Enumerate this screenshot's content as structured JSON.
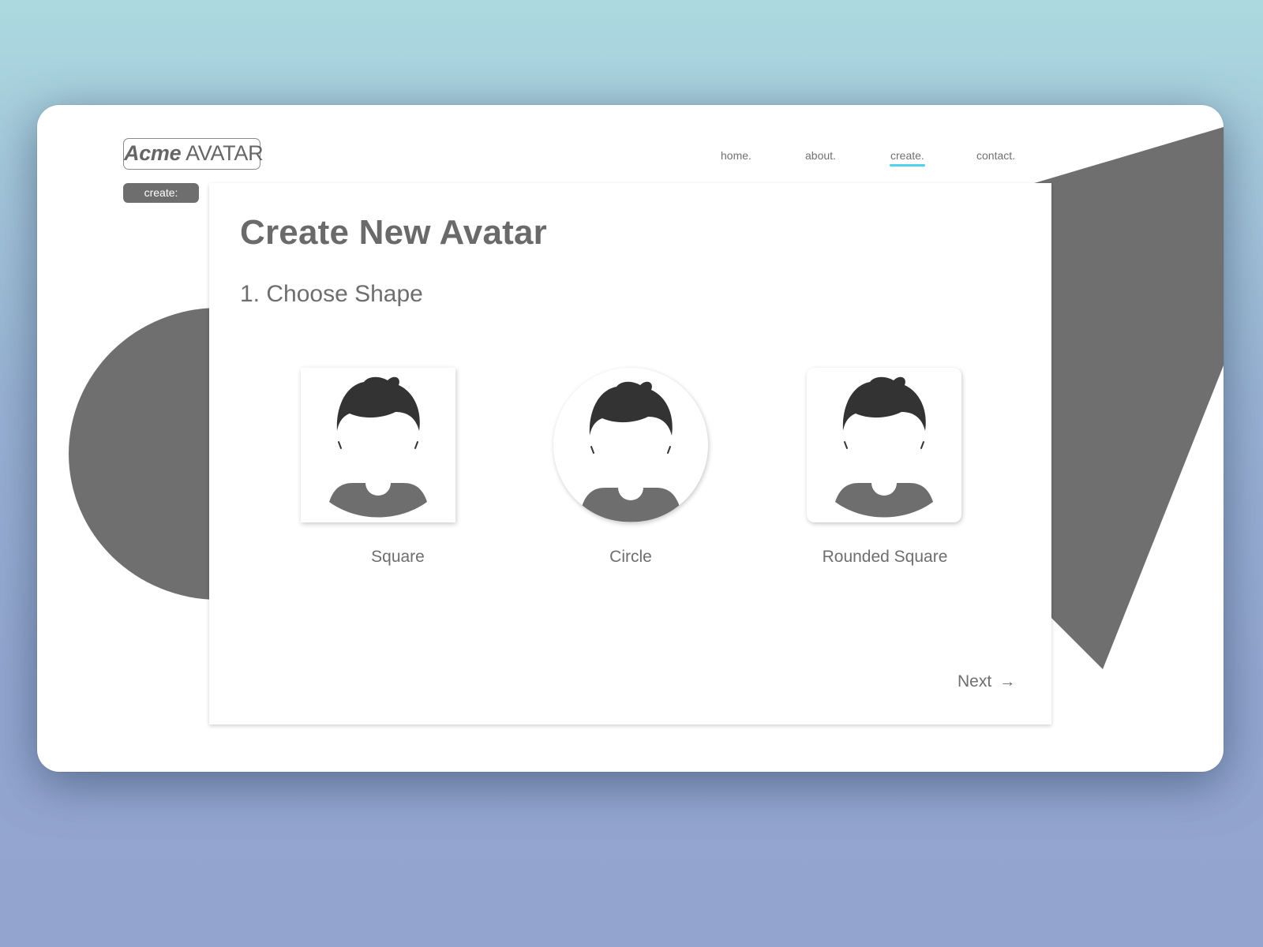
{
  "logo": {
    "brand": "Acme",
    "product": "AVATAR"
  },
  "breadcrumb_pill": "create:",
  "nav": {
    "items": [
      {
        "label": "home.",
        "active": false
      },
      {
        "label": "about.",
        "active": false
      },
      {
        "label": "create.",
        "active": true
      },
      {
        "label": "contact.",
        "active": false
      }
    ]
  },
  "main": {
    "title": "Create New Avatar",
    "step_title": "1. Choose Shape",
    "shapes": [
      {
        "label": "Square",
        "shape": "square"
      },
      {
        "label": "Circle",
        "shape": "circle"
      },
      {
        "label": "Rounded Square",
        "shape": "rounded-square"
      }
    ],
    "next_label": "Next",
    "next_icon": "arrow-right-icon",
    "next_glyph": "→"
  },
  "colors": {
    "accent": "#4fd3ee",
    "decor_gray": "#6f6f6f",
    "text_gray": "#6a6a6a",
    "hair": "#333333",
    "shirt": "#6e6e6e"
  }
}
